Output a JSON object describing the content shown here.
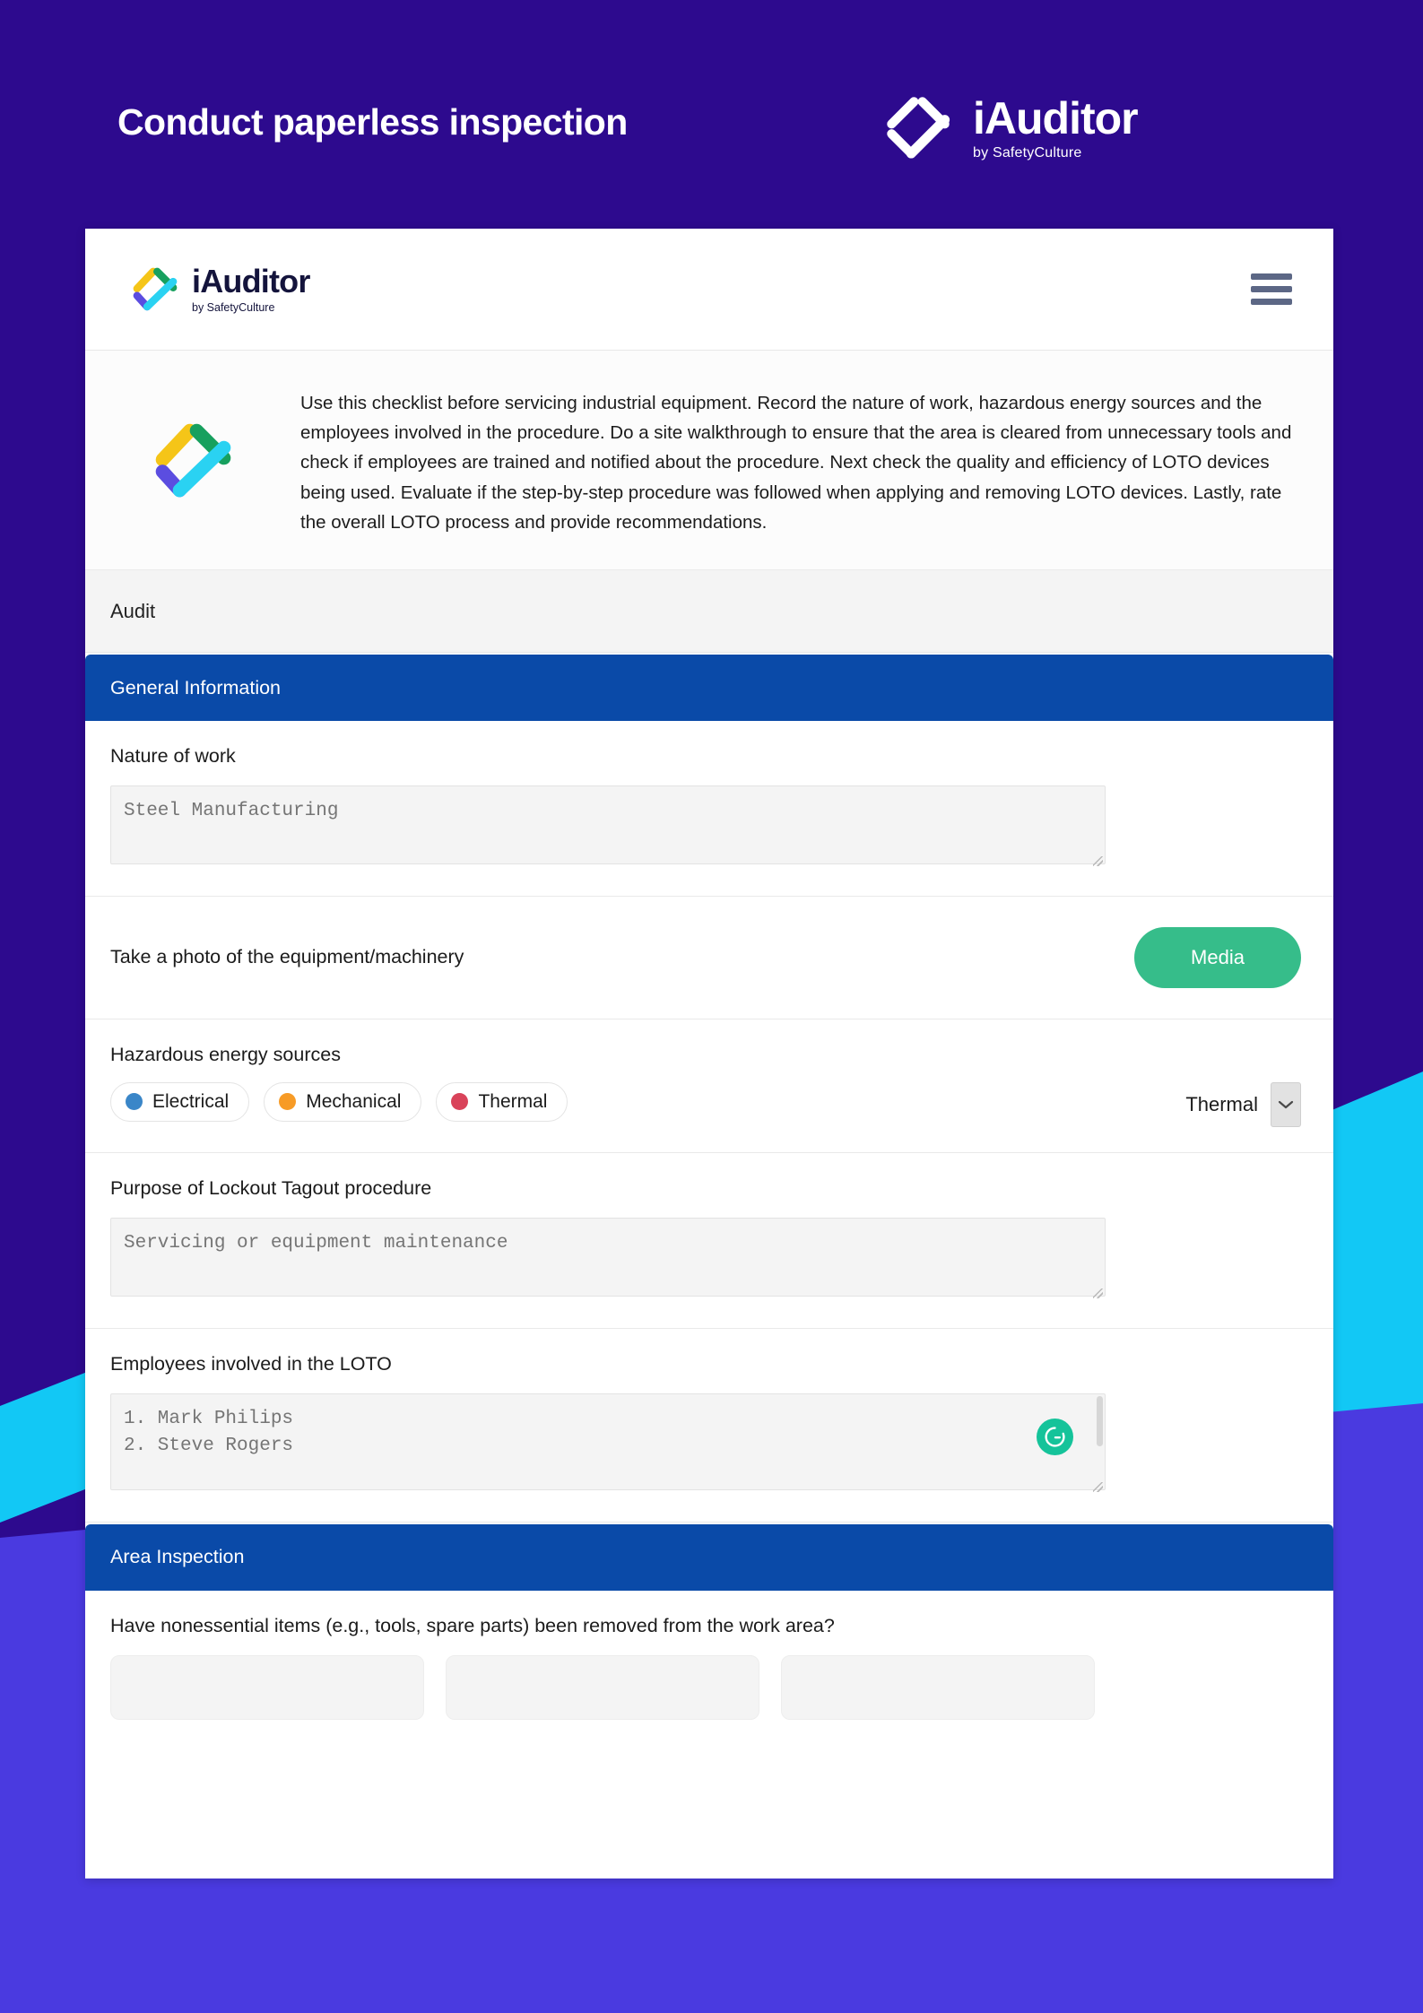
{
  "banner": {
    "title": "Conduct paperless inspection",
    "logo": {
      "name": "iAuditor",
      "tagline": "by SafetyCulture",
      "mark_icon": "iauditor-diamond-check-icon"
    }
  },
  "app": {
    "header": {
      "logo_name": "iAuditor",
      "logo_tagline": "by SafetyCulture",
      "logo_mark_icon": "iauditor-diamond-check-icon",
      "menu_icon": "hamburger-menu-icon"
    },
    "intro": {
      "icon": "iauditor-diamond-check-icon",
      "text": "Use this checklist before servicing industrial equipment. Record the nature of work, hazardous energy sources and the employees involved in the procedure. Do a site walkthrough to ensure that the area is cleared from unnecessary tools and check if employees are trained and notified about the procedure. Next check the quality and efficiency of LOTO devices being used. Evaluate if the step-by-step procedure was followed when applying and removing LOTO devices. Lastly, rate the overall LOTO process and provide recommendations."
    },
    "audit_bar_label": "Audit",
    "sections": [
      {
        "title": "General Information",
        "questions": {
          "nature_of_work": {
            "label": "Nature of work",
            "placeholder": "Steel Manufacturing",
            "value": ""
          },
          "photo": {
            "label": "Take a photo of the equipment/machinery",
            "button_label": "Media"
          },
          "hazardous": {
            "label": "Hazardous energy sources",
            "chips": [
              {
                "label": "Electrical",
                "color": "#3a86c8"
              },
              {
                "label": "Mechanical",
                "color": "#f79b26"
              },
              {
                "label": "Thermal",
                "color": "#d9435a"
              }
            ],
            "selected": "Thermal",
            "arrow_icon": "chevron-down-icon"
          },
          "purpose": {
            "label": "Purpose of Lockout Tagout procedure",
            "placeholder": "Servicing or equipment maintenance",
            "value": ""
          },
          "employees": {
            "label": "Employees involved in the LOTO",
            "placeholder": "1. Mark Philips\n2. Steve Rogers",
            "value": "",
            "assistant_icon": "grammarly-icon"
          }
        }
      },
      {
        "title": "Area Inspection",
        "questions": {
          "nonessential": {
            "label": "Have nonessential items (e.g., tools, spare parts) been removed from the work area?"
          }
        }
      }
    ]
  },
  "colors": {
    "background": "#2d0a8e",
    "accent_violet": "#4a3ae0",
    "accent_cyan": "#12c8f5",
    "section_header": "#0a4aa8",
    "media_button": "#36bd8a",
    "grammarly": "#15c39a"
  }
}
